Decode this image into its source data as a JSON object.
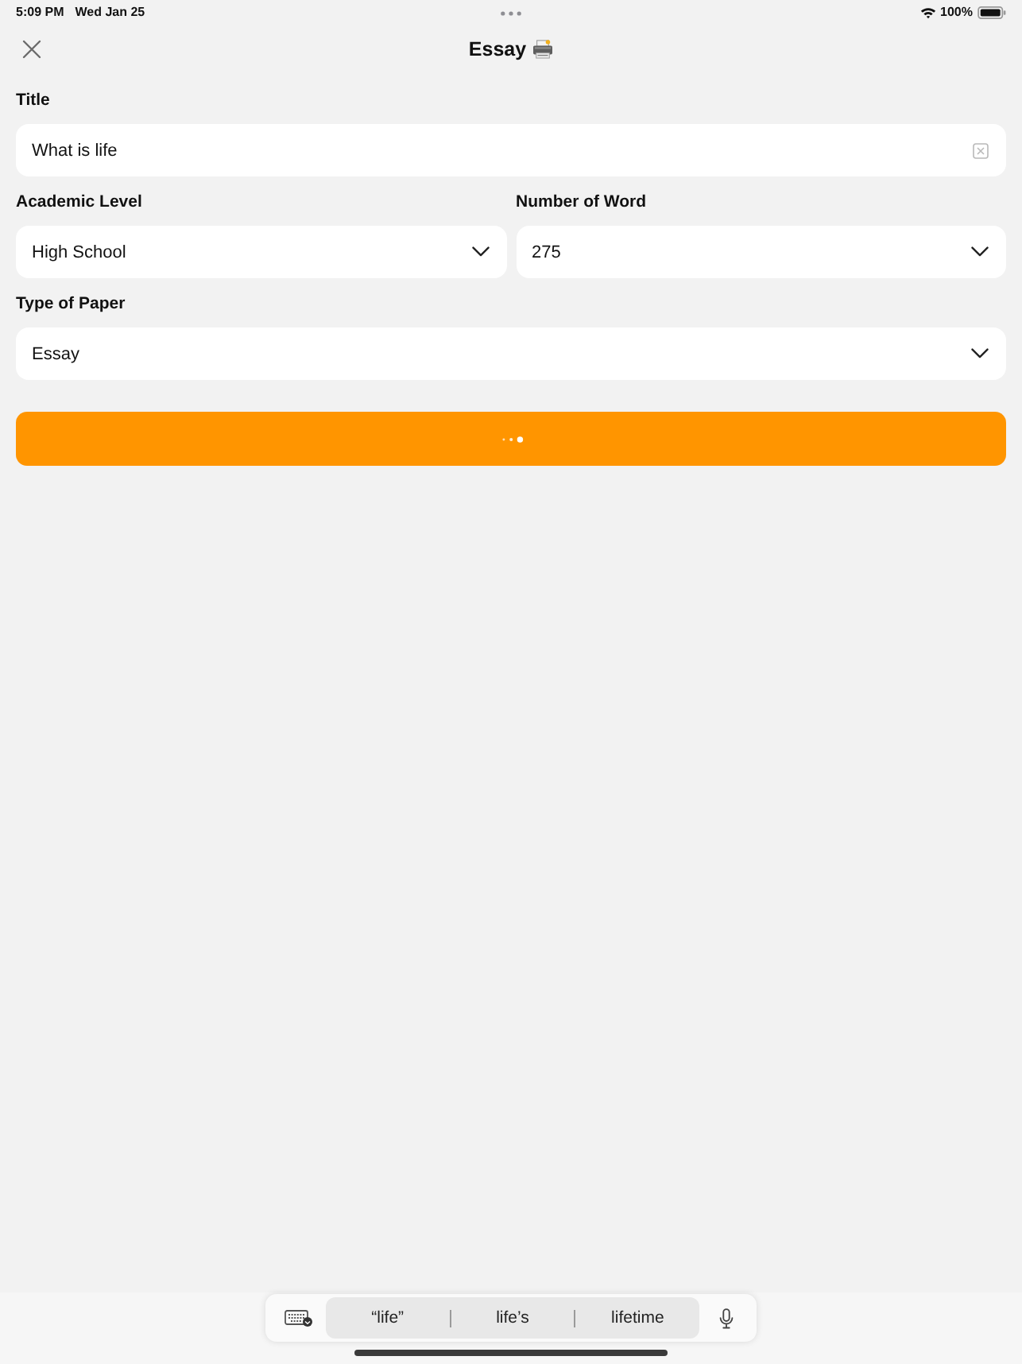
{
  "status_bar": {
    "time": "5:09 PM",
    "date": "Wed Jan 25",
    "battery": "100%"
  },
  "nav": {
    "title": "Essay"
  },
  "form": {
    "rows": [
      [
        {
          "kind": "text",
          "label": "Title",
          "value": "What is life"
        }
      ],
      [
        {
          "kind": "select",
          "label": "Academic Level",
          "value": "High School"
        },
        {
          "kind": "select",
          "label": "Number of Word",
          "value": "275"
        }
      ],
      [
        {
          "kind": "select",
          "label": "Type of Paper",
          "value": "Essay"
        }
      ]
    ]
  },
  "submit_button": {
    "loading": true
  },
  "keyboard_bar": {
    "suggestions": [
      "“life”",
      "life’s",
      "lifetime"
    ]
  }
}
